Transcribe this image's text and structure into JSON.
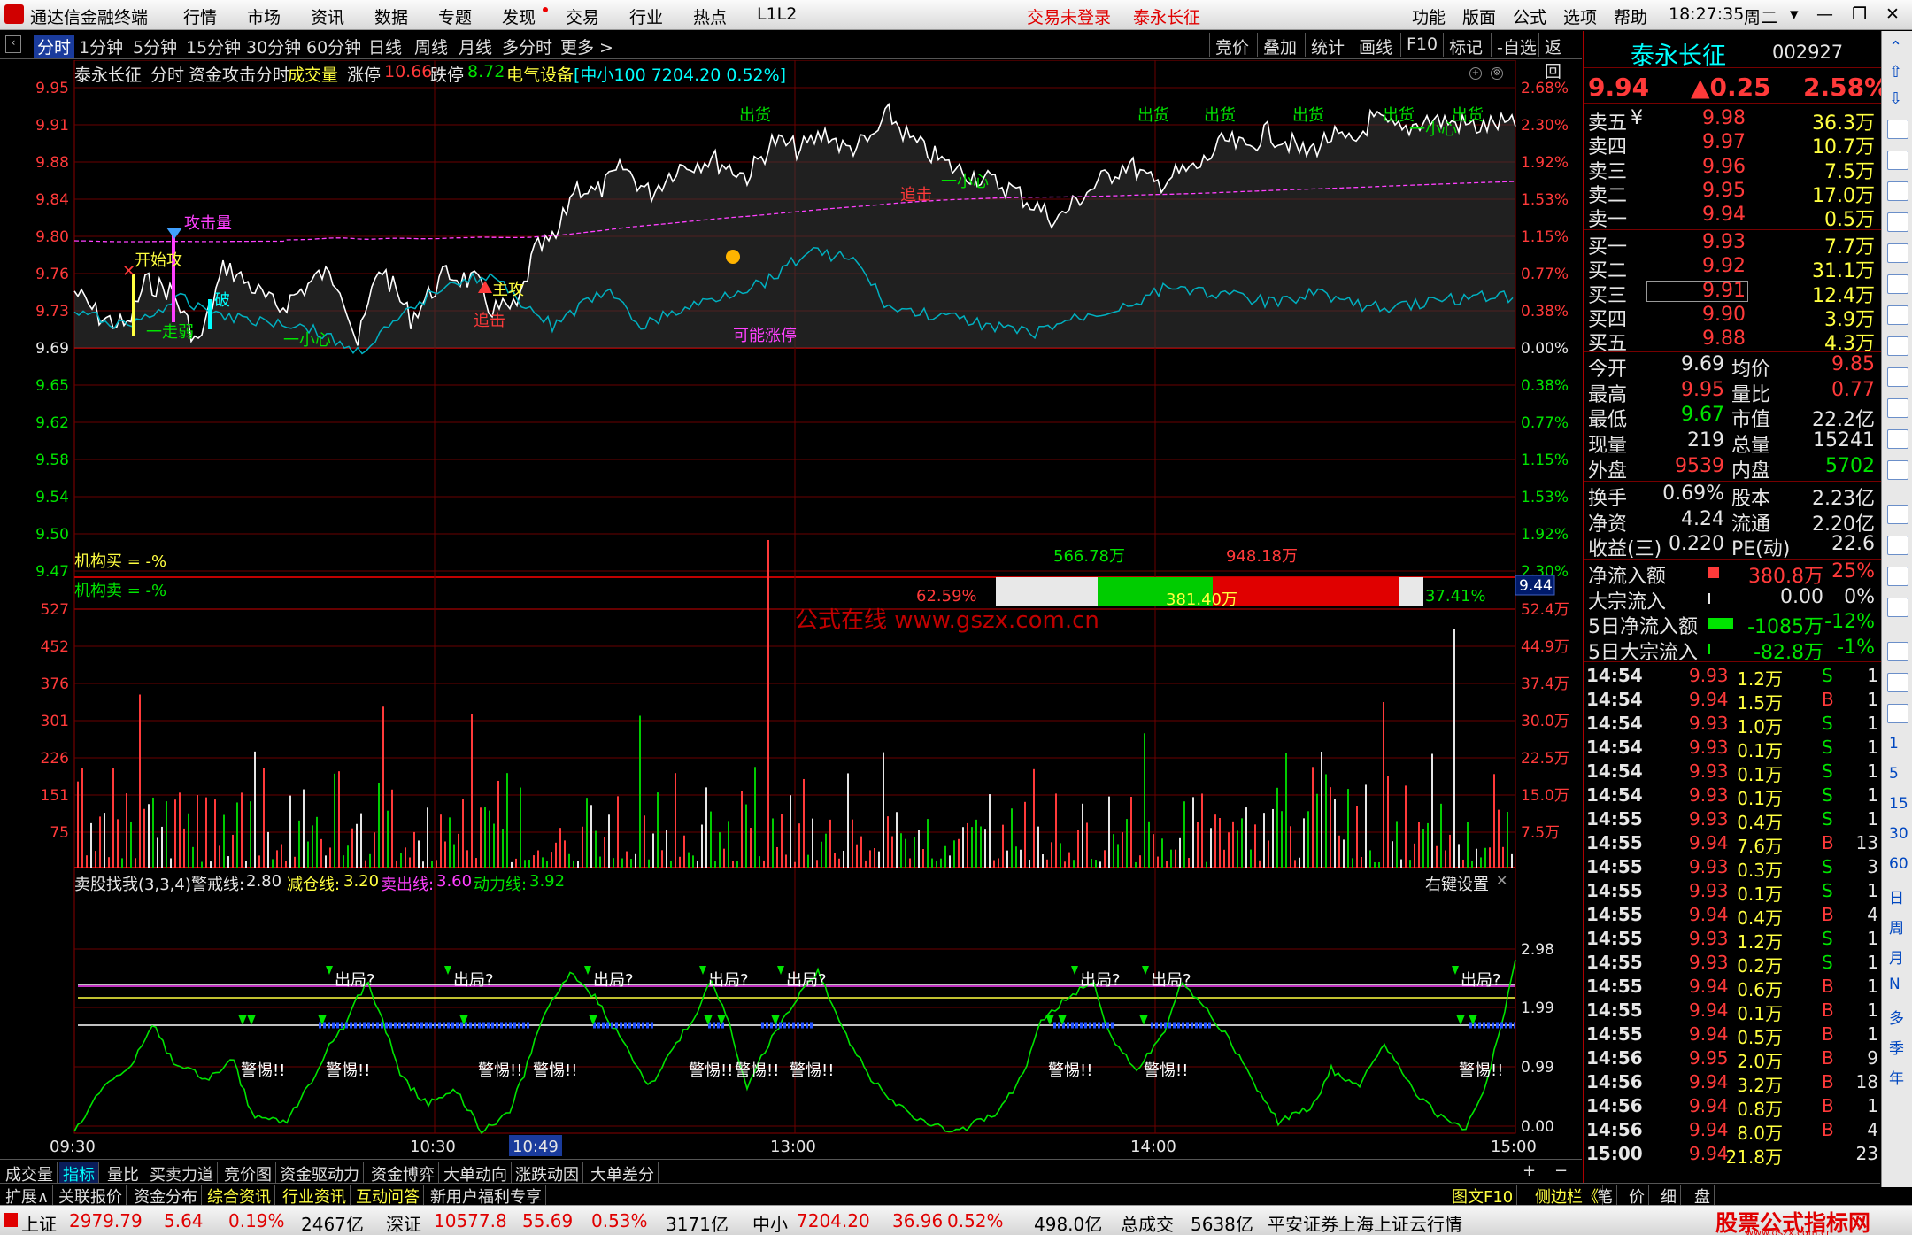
{
  "menu": {
    "app_title": "通达信金融终端",
    "items": [
      "行情",
      "市场",
      "资讯",
      "数据",
      "专题",
      "发现",
      "交易",
      "行业",
      "热点",
      "L1L2"
    ],
    "trade_status": "交易未登录",
    "stock_link": "泰永长征",
    "right_items": [
      "功能",
      "版面",
      "公式",
      "选项",
      "帮助"
    ],
    "time": "18:27:35",
    "weekday": "周二"
  },
  "subbar": {
    "periods": [
      "分时",
      "1分钟",
      "5分钟",
      "15分钟",
      "30分钟",
      "60分钟",
      "日线",
      "周线",
      "月线",
      "多分时",
      "更多 >"
    ],
    "active": "分时",
    "tools": [
      "竞价",
      "叠加",
      "统计",
      "画线",
      "F10",
      "标记",
      "-自选",
      "返回"
    ]
  },
  "chart": {
    "title_name": "泰永长征",
    "title_mode": "分时",
    "title_formula": "资金攻击分时",
    "title_vol": "成交量",
    "zt_label": "涨停",
    "zt_value": "10.66",
    "dt_label": "跌停",
    "dt_value": "8.72",
    "sector": "电气设备",
    "index_info": "[中小100 7204.20 0.52%]",
    "price_ticks": [
      "9.95",
      "9.91",
      "9.88",
      "9.84",
      "9.80",
      "9.76",
      "9.73",
      "9.69",
      "9.65",
      "9.62",
      "9.58",
      "9.54",
      "9.50",
      "9.47"
    ],
    "pct_ticks": [
      "2.68%",
      "2.30%",
      "1.92%",
      "1.53%",
      "1.15%",
      "0.77%",
      "0.38%",
      "0.00%",
      "0.38%",
      "0.77%",
      "1.15%",
      "1.53%",
      "1.92%",
      "2.30%"
    ],
    "vol_ticks": [
      "527",
      "452",
      "376",
      "301",
      "226",
      "151",
      "75"
    ],
    "vol_amt_ticks": [
      "52.4万",
      "44.9万",
      "37.4万",
      "30.0万",
      "22.5万",
      "15.0万",
      "7.5万"
    ],
    "ind_ticks": [
      "2.98",
      "1.99",
      "0.99",
      "0.00"
    ],
    "time_ticks": [
      "09:30",
      "10:30",
      "10:49",
      "13:00",
      "14:00",
      "15:00"
    ],
    "cursor_price": "9.44",
    "inst_buy": "机构买 = -%",
    "inst_sell": "机构卖 = -%",
    "bar_left_value": "566.78万",
    "bar_right_value": "948.18万",
    "bar_left_pct": "62.59%",
    "bar_mid_value": "381.40万",
    "bar_right_pct": "37.41%",
    "watermark": "公式在线  www.gszx.com.cn",
    "annotations": {
      "attack_vol": "攻击量",
      "start_attack": "开始攻",
      "weak": "一走弱",
      "break": "破",
      "careful": "一小心",
      "main_attack": "主攻",
      "chase": "追击",
      "maybe_zt": "可能涨停",
      "ship": "出货",
      "chase2": "追击",
      "careful2": "一小心",
      "careful3": "一小心"
    },
    "ind": {
      "name": "卖股找我(3,3,4)",
      "warn_label": "警戒线:",
      "warn_val": "2.80",
      "reduce_label": "减仓线:",
      "reduce_val": "3.20",
      "sell_label": "卖出线:",
      "sell_val": "3.60",
      "power_label": "动力线:",
      "power_val": "3.92",
      "settings": "右键设置",
      "exit_text": "出局?",
      "alert_text": "警惕!!"
    },
    "colors": {
      "up": "#ff3a3a",
      "down": "#00e400",
      "avg": "#ff40ff",
      "price": "#ffffff",
      "cyan": "#00b0c0",
      "grid": "#7a0000"
    }
  },
  "panel": {
    "name": "泰永长征",
    "code": "002927",
    "price": "9.94",
    "change": "▲0.25",
    "pct": "2.58%",
    "asks": [
      {
        "l": "卖五",
        "p": "9.98",
        "v": "36.3万"
      },
      {
        "l": "卖四",
        "p": "9.97",
        "v": "10.7万"
      },
      {
        "l": "卖三",
        "p": "9.96",
        "v": "7.5万"
      },
      {
        "l": "卖二",
        "p": "9.95",
        "v": "17.0万"
      },
      {
        "l": "卖一",
        "p": "9.94",
        "v": "0.5万"
      }
    ],
    "ask5_mark": "¥",
    "bids": [
      {
        "l": "买一",
        "p": "9.93",
        "v": "7.7万"
      },
      {
        "l": "买二",
        "p": "9.92",
        "v": "31.1万"
      },
      {
        "l": "买三",
        "p": "9.91",
        "v": "12.4万"
      },
      {
        "l": "买四",
        "p": "9.90",
        "v": "3.9万"
      },
      {
        "l": "买五",
        "p": "9.88",
        "v": "4.3万"
      }
    ],
    "stats": [
      {
        "a": "今开",
        "av": "9.69",
        "b": "均价",
        "bv": "9.85",
        "ac": "w",
        "bc": "r"
      },
      {
        "a": "最高",
        "av": "9.95",
        "b": "量比",
        "bv": "0.77",
        "ac": "r",
        "bc": "r"
      },
      {
        "a": "最低",
        "av": "9.67",
        "b": "市值",
        "bv": "22.2亿",
        "ac": "g",
        "bc": "w"
      },
      {
        "a": "现量",
        "av": "219",
        "b": "总量",
        "bv": "15241",
        "ac": "w",
        "bc": "w"
      },
      {
        "a": "外盘",
        "av": "9539",
        "b": "内盘",
        "bv": "5702",
        "ac": "r",
        "bc": "g"
      }
    ],
    "stats2": [
      {
        "a": "换手",
        "av": "0.69%",
        "b": "股本",
        "bv": "2.23亿"
      },
      {
        "a": "净资",
        "av": "4.24",
        "b": "流通",
        "bv": "2.20亿"
      },
      {
        "a": "收益(三)",
        "av": "0.220",
        "b": "PE(动)",
        "bv": "22.6"
      }
    ],
    "flows": [
      {
        "l": "净流入额",
        "v": "380.8万",
        "p": "25%",
        "c": "r"
      },
      {
        "l": "大宗流入",
        "v": "0.00",
        "p": "0%",
        "c": "w"
      },
      {
        "l": "5日净流入额",
        "v": "-1085万",
        "p": "-12%",
        "c": "g"
      },
      {
        "l": "5日大宗流入",
        "v": "-82.8万",
        "p": "-1%",
        "c": "g"
      }
    ],
    "ticks": [
      [
        "14:54",
        "9.93",
        "1.2万",
        "S",
        "1"
      ],
      [
        "14:54",
        "9.94",
        "1.5万",
        "B",
        "1"
      ],
      [
        "14:54",
        "9.93",
        "1.0万",
        "S",
        "1"
      ],
      [
        "14:54",
        "9.93",
        "0.1万",
        "S",
        "1"
      ],
      [
        "14:54",
        "9.93",
        "0.1万",
        "S",
        "1"
      ],
      [
        "14:54",
        "9.93",
        "0.1万",
        "S",
        "1"
      ],
      [
        "14:55",
        "9.93",
        "0.4万",
        "S",
        "1"
      ],
      [
        "14:55",
        "9.94",
        "7.6万",
        "B",
        "13"
      ],
      [
        "14:55",
        "9.93",
        "0.3万",
        "S",
        "3"
      ],
      [
        "14:55",
        "9.93",
        "0.1万",
        "S",
        "1"
      ],
      [
        "14:55",
        "9.94",
        "0.4万",
        "B",
        "4"
      ],
      [
        "14:55",
        "9.93",
        "1.2万",
        "S",
        "1"
      ],
      [
        "14:55",
        "9.93",
        "0.2万",
        "S",
        "1"
      ],
      [
        "14:55",
        "9.94",
        "0.6万",
        "B",
        "1"
      ],
      [
        "14:55",
        "9.94",
        "0.1万",
        "B",
        "1"
      ],
      [
        "14:55",
        "9.94",
        "0.5万",
        "B",
        "1"
      ],
      [
        "14:56",
        "9.95",
        "2.0万",
        "B",
        "9"
      ],
      [
        "14:56",
        "9.94",
        "3.2万",
        "B",
        "18"
      ],
      [
        "14:56",
        "9.94",
        "0.8万",
        "B",
        "1"
      ],
      [
        "14:56",
        "9.94",
        "8.0万",
        "B",
        "4"
      ],
      [
        "15:00",
        "9.94",
        "21.8万",
        "",
        "23"
      ]
    ]
  },
  "side_tools": [
    "1",
    "5",
    "15",
    "30",
    "60",
    "日",
    "周",
    "月",
    "N",
    "多",
    "季",
    "年"
  ],
  "tabs1": [
    "成交量",
    "指标",
    "量比",
    "买卖力道",
    "竞价图",
    "资金驱动力",
    "资金博弈",
    "大单动向",
    "涨跌动因",
    "大单差分"
  ],
  "tabs1_active": "指标",
  "tabs2": [
    "扩展∧",
    "关联报价",
    "资金分布",
    "综合资讯",
    "行业资讯",
    "互动问答",
    "新用户福利专享"
  ],
  "tabs2_right": [
    "图文F10",
    "侧边栏《",
    "笔",
    "价",
    "细",
    "盘"
  ],
  "status": {
    "sh_label": "上证",
    "sh_val": "2979.79",
    "sh_chg": "5.64",
    "sh_pct": "0.19%",
    "sh_amt": "2467亿",
    "sz_label": "深证",
    "sz_val": "10577.8",
    "sz_chg": "55.69",
    "sz_pct": "0.53%",
    "sz_amt": "3171亿",
    "zx_label": "中小",
    "zx_val": "7204.20",
    "zx_chg": "36.96",
    "zx_pct": "0.52%",
    "zx_amt": "498.0亿",
    "total_label": "总成交",
    "total_val": "5638亿",
    "server": "平安证券上海上证云行情",
    "logo_top": "股票公式指标网",
    "logo_url": "www.gszx.com.cn"
  }
}
